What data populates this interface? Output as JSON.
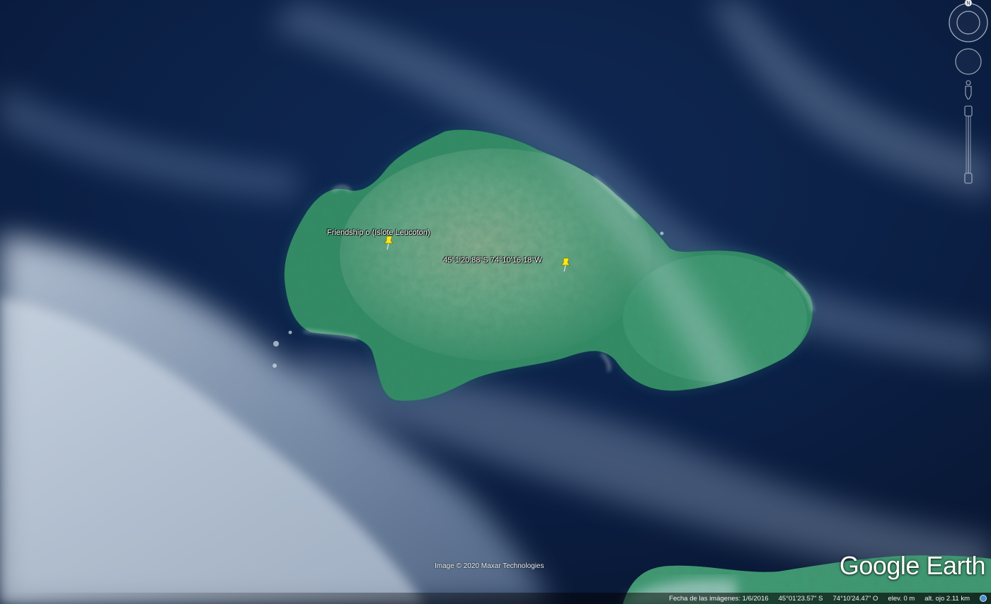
{
  "app": {
    "brand": "Google Earth",
    "attribution": "Image © 2020 Maxar Technologies"
  },
  "placemarks": [
    {
      "label": "Friendship o (Islote Leucoton)",
      "icon": "yellow-pushpin-icon"
    },
    {
      "label": "45°1'20.88\"S  74°10'16.18\"W",
      "icon": "yellow-pushpin-icon"
    }
  ],
  "status_bar": {
    "imagery_date": "Fecha de las imágenes: 1/6/2016",
    "latitude": "45°01'23.57\" S",
    "longitude": "74°10'24.47\" O",
    "elevation": "elev.    0 m",
    "eye_altitude": "alt. ojo  2.11 km"
  },
  "navigation": {
    "compass_label": "N",
    "icons": [
      "compass-icon",
      "look-joystick-icon",
      "street-view-pegman-icon",
      "zoom-slider-icon"
    ]
  },
  "colors": {
    "ocean": "#0c2146",
    "island_vegetation": "#3f9a6f",
    "cloud": "#b7c9dd",
    "pin": "#f5ea1c"
  }
}
